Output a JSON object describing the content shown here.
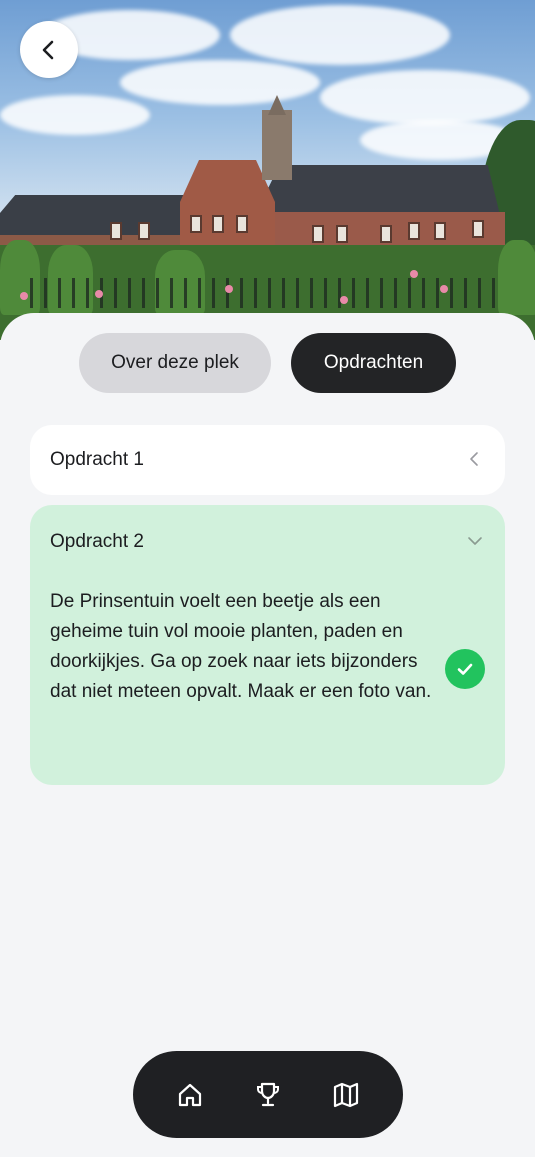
{
  "header": {
    "back_icon": "chevron-left-icon"
  },
  "tabs": [
    {
      "label": "Over deze plek",
      "active": false
    },
    {
      "label": "Opdrachten",
      "active": true
    }
  ],
  "assignments": [
    {
      "title": "Opdracht 1",
      "expanded": false,
      "icon": "chevron-left-icon"
    },
    {
      "title": "Opdracht 2",
      "expanded": true,
      "icon": "chevron-down-icon",
      "body": "De Prinsentuin voelt een beetje als een geheime tuin vol mooie planten, paden en doorkijkjes. Ga op zoek naar iets bijzonders dat niet meteen opvalt. Maak er een foto van.",
      "completed": true
    }
  ],
  "bottom_nav": [
    {
      "icon": "home-icon"
    },
    {
      "icon": "trophy-icon"
    },
    {
      "icon": "map-icon"
    }
  ],
  "colors": {
    "background": "#f4f5f7",
    "active_tab": "#232426",
    "inactive_tab": "#d7d7db",
    "completed_card": "#d1f1dc",
    "check": "#22c35e",
    "nav": "#1f2023"
  }
}
